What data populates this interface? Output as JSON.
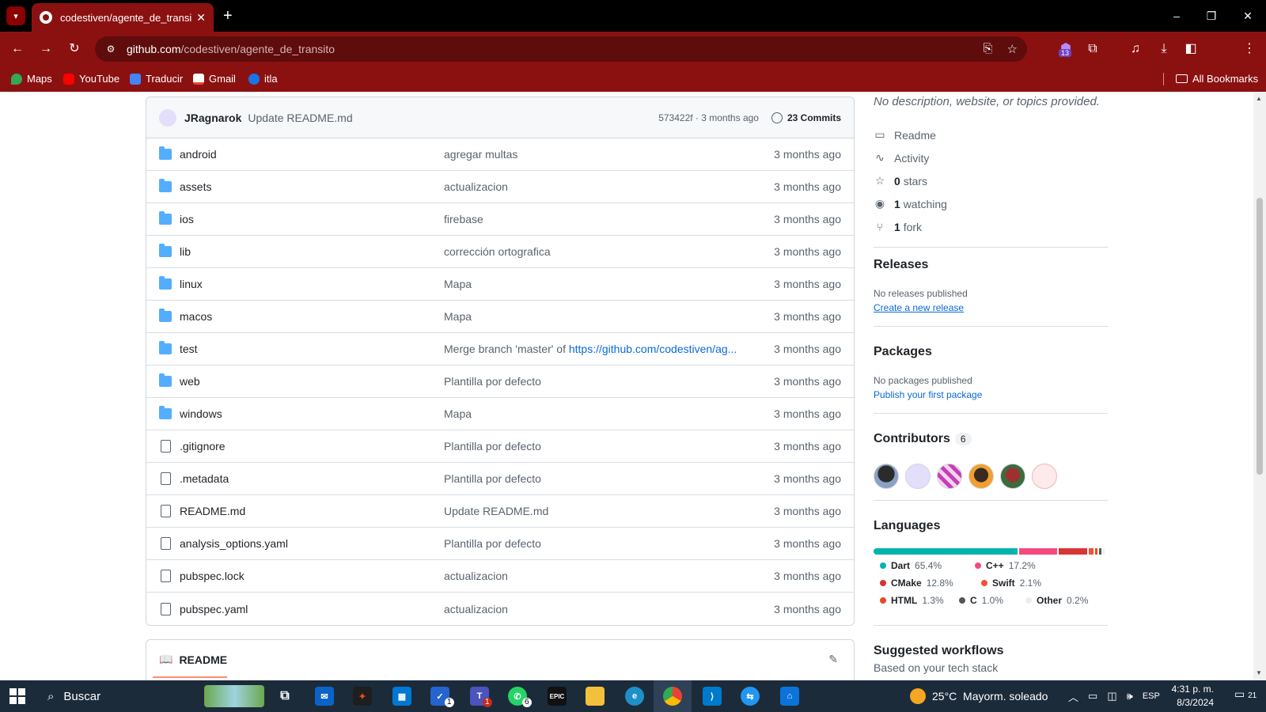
{
  "browser": {
    "tab_title": "codestiven/agente_de_transito",
    "url_host": "github.com",
    "url_path": "/codestiven/agente_de_transito",
    "extension_badge": "13",
    "bookmarks": [
      {
        "label": "Maps",
        "color": "#34a853"
      },
      {
        "label": "YouTube",
        "color": "#ff0000"
      },
      {
        "label": "Traducir",
        "color": "#4285f4"
      },
      {
        "label": "Gmail",
        "color": "#ea4335"
      },
      {
        "label": "itla",
        "color": "#1a73e8"
      }
    ],
    "all_bookmarks": "All Bookmarks"
  },
  "repo": {
    "last_commit": {
      "author": "JRagnarok",
      "message": "Update README.md",
      "sha_time": "573422f · 3 months ago",
      "commits": "23 Commits"
    },
    "files": [
      {
        "type": "folder",
        "name": "android",
        "message": "agregar multas",
        "date": "3 months ago"
      },
      {
        "type": "folder",
        "name": "assets",
        "message": "actualizacion",
        "date": "3 months ago"
      },
      {
        "type": "folder",
        "name": "ios",
        "message": "firebase",
        "date": "3 months ago"
      },
      {
        "type": "folder",
        "name": "lib",
        "message": "corrección ortografica",
        "date": "3 months ago"
      },
      {
        "type": "folder",
        "name": "linux",
        "message": "Mapa",
        "date": "3 months ago"
      },
      {
        "type": "folder",
        "name": "macos",
        "message": "Mapa",
        "date": "3 months ago"
      },
      {
        "type": "folder",
        "name": "test",
        "message": "Merge branch 'master' of ",
        "message_link": "https://github.com/codestiven/ag...",
        "date": "3 months ago"
      },
      {
        "type": "folder",
        "name": "web",
        "message": "Plantilla por defecto",
        "date": "3 months ago"
      },
      {
        "type": "folder",
        "name": "windows",
        "message": "Mapa",
        "date": "3 months ago"
      },
      {
        "type": "file",
        "name": ".gitignore",
        "message": "Plantilla por defecto",
        "date": "3 months ago"
      },
      {
        "type": "file",
        "name": ".metadata",
        "message": "Plantilla por defecto",
        "date": "3 months ago"
      },
      {
        "type": "file",
        "name": "README.md",
        "message": "Update README.md",
        "date": "3 months ago"
      },
      {
        "type": "file",
        "name": "analysis_options.yaml",
        "message": "Plantilla por defecto",
        "date": "3 months ago"
      },
      {
        "type": "file",
        "name": "pubspec.lock",
        "message": "actualizacion",
        "date": "3 months ago"
      },
      {
        "type": "file",
        "name": "pubspec.yaml",
        "message": "actualizacion",
        "date": "3 months ago"
      }
    ],
    "readme_tab": "README"
  },
  "sidebar": {
    "about": "No description, website, or topics provided.",
    "meta": {
      "readme": "Readme",
      "activity": "Activity",
      "stars_count": "0",
      "stars_label": "stars",
      "watching_count": "1",
      "watching_label": "watching",
      "fork_count": "1",
      "fork_label": "fork"
    },
    "releases": {
      "title": "Releases",
      "empty": "No releases published",
      "link": "Create a new release"
    },
    "packages": {
      "title": "Packages",
      "empty": "No packages published",
      "link": "Publish your first package"
    },
    "contributors": {
      "title": "Contributors",
      "count": "6"
    },
    "languages": {
      "title": "Languages",
      "items": [
        {
          "name": "Dart",
          "pct": "65.4%",
          "value": 65.4,
          "color": "#00B4AB"
        },
        {
          "name": "C++",
          "pct": "17.2%",
          "value": 17.2,
          "color": "#f34b7d"
        },
        {
          "name": "CMake",
          "pct": "12.8%",
          "value": 12.8,
          "color": "#DA3434"
        },
        {
          "name": "Swift",
          "pct": "2.1%",
          "value": 2.1,
          "color": "#F05138"
        },
        {
          "name": "HTML",
          "pct": "1.3%",
          "value": 1.3,
          "color": "#e34c26"
        },
        {
          "name": "C",
          "pct": "1.0%",
          "value": 1.0,
          "color": "#555555"
        },
        {
          "name": "Other",
          "pct": "0.2%",
          "value": 0.2,
          "color": "#ededed"
        }
      ]
    },
    "workflows": {
      "title": "Suggested workflows",
      "subtitle": "Based on your tech stack"
    }
  },
  "taskbar": {
    "search": "Buscar",
    "weather": "25°C  Mayorm. soleado",
    "lang": "ESP",
    "time": "4:31 p. m.",
    "date": "8/3/2024",
    "notifications": "21",
    "badges": {
      "teams": "1",
      "todo": "1",
      "whatsapp": "6"
    }
  }
}
